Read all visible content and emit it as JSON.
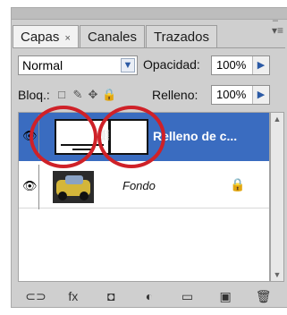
{
  "panel": {
    "tabs": [
      {
        "label": "Capas",
        "close": "×"
      },
      {
        "label": "Canales"
      },
      {
        "label": "Trazados"
      }
    ],
    "menu_icon": "panel-menu-icon",
    "close_icon": "close-icon"
  },
  "blend": {
    "value": "Normal"
  },
  "opacity": {
    "label": "Opacidad:",
    "value": "100%"
  },
  "lock": {
    "label": "Bloq.:"
  },
  "fill": {
    "label": "Relleno:",
    "value": "100%"
  },
  "layers": [
    {
      "name": "Relleno de c...",
      "selected": true,
      "visible": true
    },
    {
      "name": "Fondo",
      "selected": false,
      "visible": true,
      "locked": true
    }
  ],
  "bottom_icons": [
    "link-icon",
    "fx-icon",
    "mask-icon",
    "adjustment-icon",
    "folder-icon",
    "new-layer-icon",
    "trash-icon"
  ],
  "colors": {
    "selected_row": "#3a6cc0",
    "annotation_circle": "#cf2128"
  }
}
